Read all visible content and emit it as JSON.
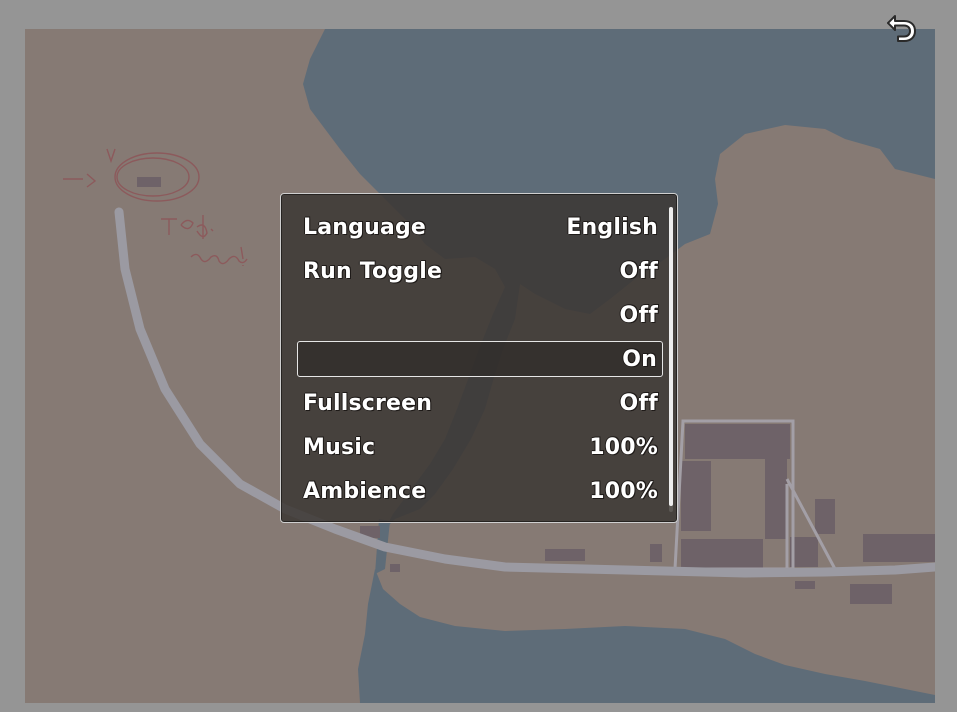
{
  "game": {
    "back_icon": "undo-arrow-icon",
    "map": {
      "colors": {
        "land": "#867a74",
        "water": "#5e6c78",
        "road": "#9b9aa2",
        "buildings": "#6e6268",
        "ink_sketch": "#8c5a5c"
      }
    },
    "settings": {
      "rows": [
        {
          "label": "Language",
          "value": "English"
        },
        {
          "label": "Run Toggle",
          "value": "Off"
        },
        {
          "label": "",
          "value": "Off"
        },
        {
          "label": "",
          "value": "On",
          "selected": true
        },
        {
          "label": "Fullscreen",
          "value": "Off"
        },
        {
          "label": "Music",
          "value": "100%"
        },
        {
          "label": "Ambience",
          "value": "100%"
        }
      ],
      "scroll_visible_fraction": 0.98,
      "scroll_position": 0.0
    }
  }
}
